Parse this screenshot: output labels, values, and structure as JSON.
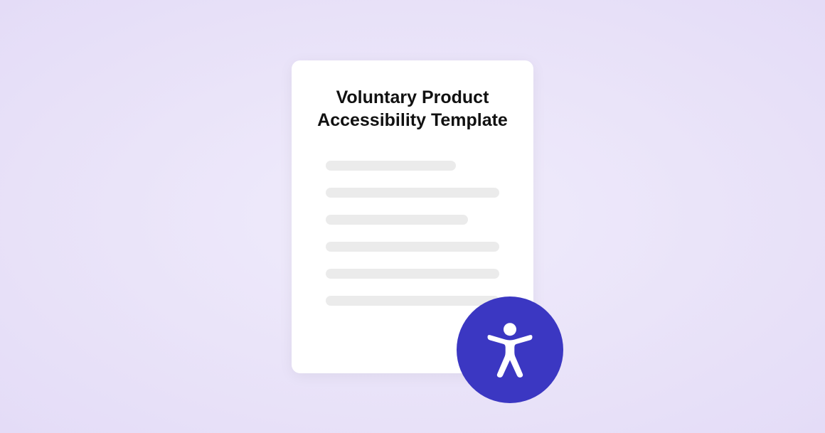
{
  "document": {
    "title": "Voluntary Product Accessibility Template"
  },
  "badge": {
    "icon_name": "accessibility-icon",
    "color": "#3b37c2"
  }
}
